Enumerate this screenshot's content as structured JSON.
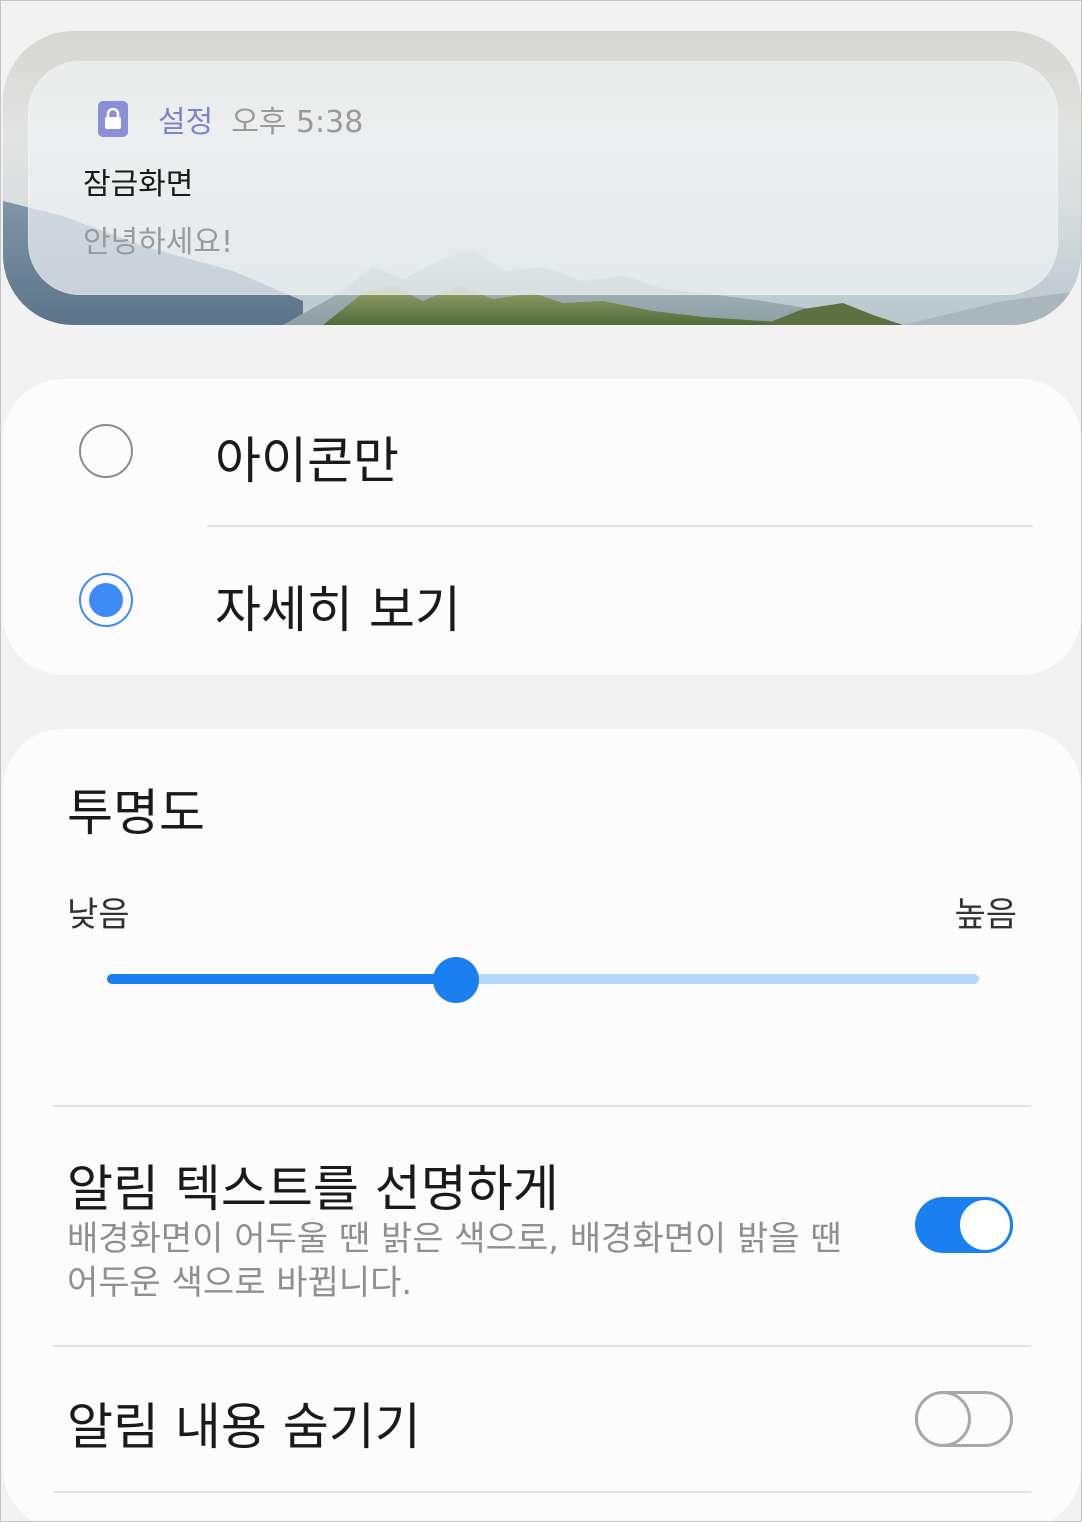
{
  "preview": {
    "app_name": "설정",
    "time": "오후 5:38",
    "title": "잠금화면",
    "text": "안녕하세요!",
    "app_icon": "lock-icon"
  },
  "view_style": {
    "options": [
      {
        "label": "아이콘만",
        "selected": false
      },
      {
        "label": "자세히 보기",
        "selected": true
      }
    ]
  },
  "transparency": {
    "title": "투명도",
    "low_label": "낮음",
    "high_label": "높음",
    "value_fraction": 0.4
  },
  "bold_text": {
    "title": "알림 텍스트를 선명하게",
    "description": "배경화면이 어두울 땐 밝은 색으로, 배경화면이 밝을 땐 어두운 색으로 바뀝니다.",
    "enabled": true
  },
  "hide_content": {
    "title": "알림 내용 숨기기",
    "enabled": false
  },
  "colors": {
    "accent": "#1a80f0",
    "radio_accent": "#3e8bf6",
    "track_light": "#b3d8fb",
    "app_name": "#7a86c8"
  }
}
